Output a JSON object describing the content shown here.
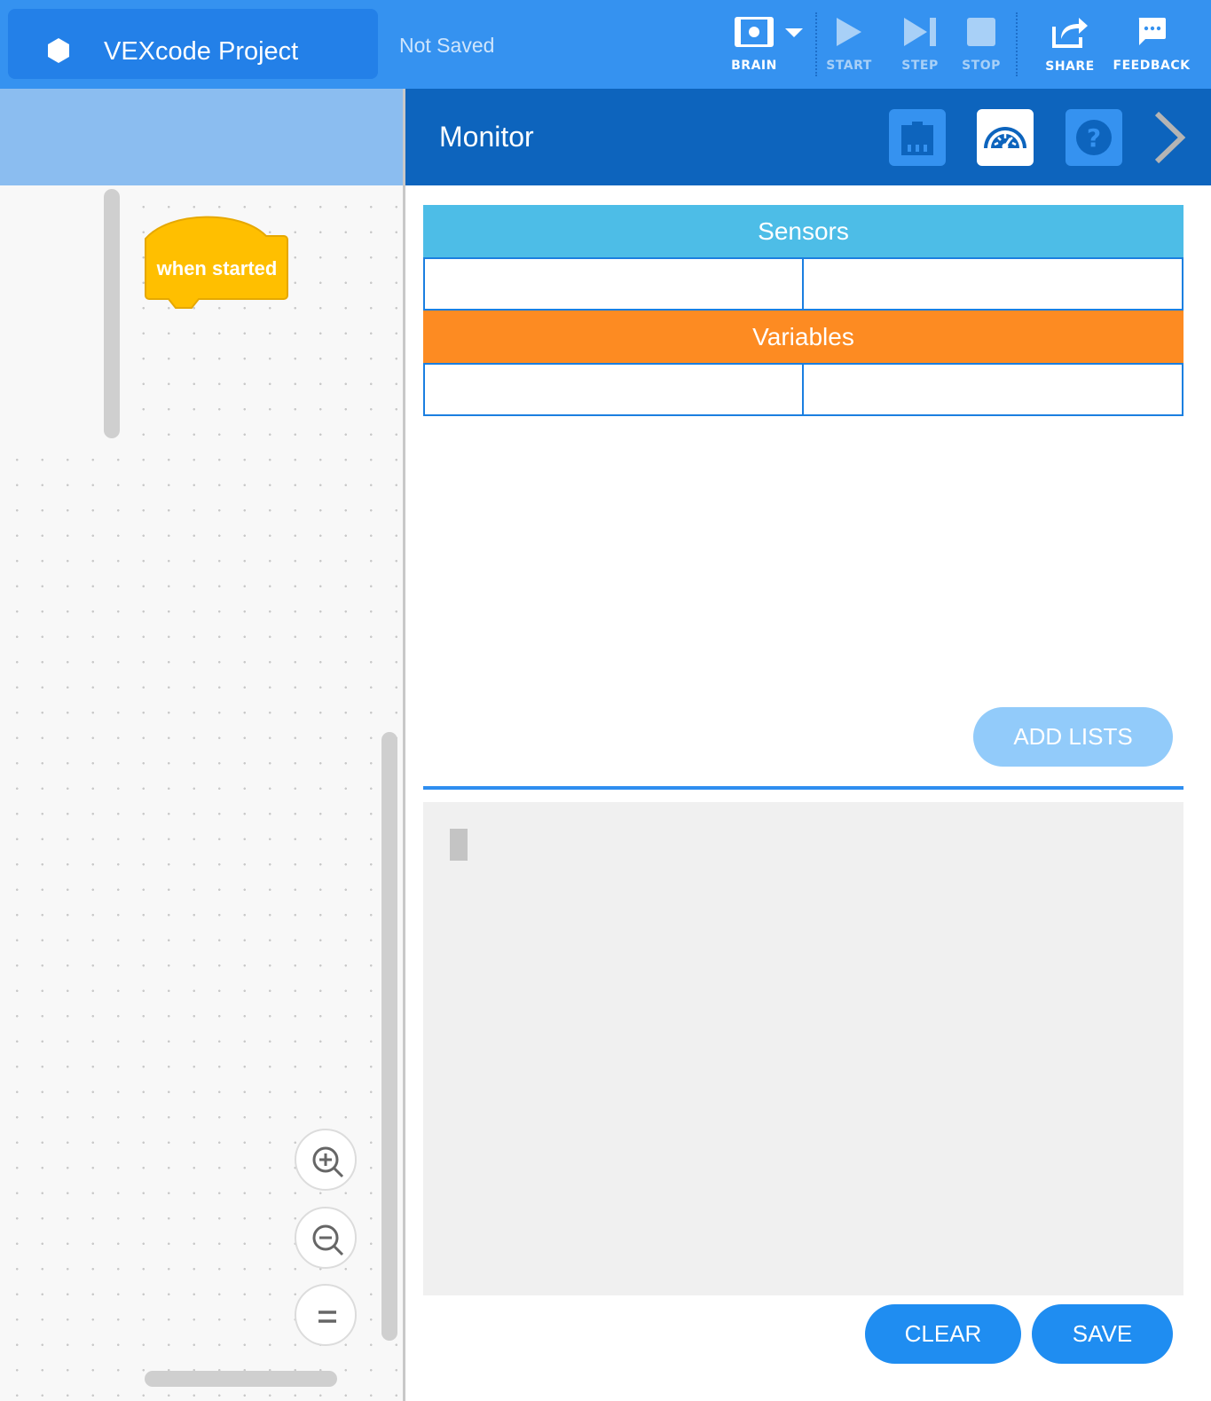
{
  "header": {
    "project_title": "VEXcode Project",
    "save_status": "Not Saved",
    "tools": {
      "brain": "BRAIN",
      "start": "START",
      "step": "STEP",
      "stop": "STOP",
      "share": "SHARE",
      "feedback": "FEEDBACK"
    },
    "icons": {
      "logo": "hexagon-logo-icon",
      "brain": "brain-icon",
      "brain_dropdown": "chevron-down-icon",
      "start": "play-icon",
      "step": "step-icon",
      "stop": "stop-icon",
      "share": "share-icon",
      "feedback": "chat-icon"
    }
  },
  "workspace": {
    "blocks": [
      {
        "label": "when started",
        "color": "#ffbf00"
      }
    ],
    "zoom_controls": [
      "zoom-in-icon",
      "zoom-out-icon",
      "reset-zoom-icon"
    ]
  },
  "monitor": {
    "title": "Monitor",
    "header_icons": [
      "devices-icon",
      "dashboard-gauge-icon",
      "help-icon",
      "chevron-right-icon"
    ],
    "sections": {
      "sensors": "Sensors",
      "variables": "Variables"
    },
    "add_lists_label": "ADD LISTS",
    "clear_label": "CLEAR",
    "save_label": "SAVE"
  },
  "colors": {
    "toolbar": "#3592f0",
    "monitor_header": "#0d64bd",
    "sensors": "#4dbde7",
    "variables": "#fd8b22",
    "accent_button": "#1f8df1",
    "block": "#ffbf00"
  }
}
